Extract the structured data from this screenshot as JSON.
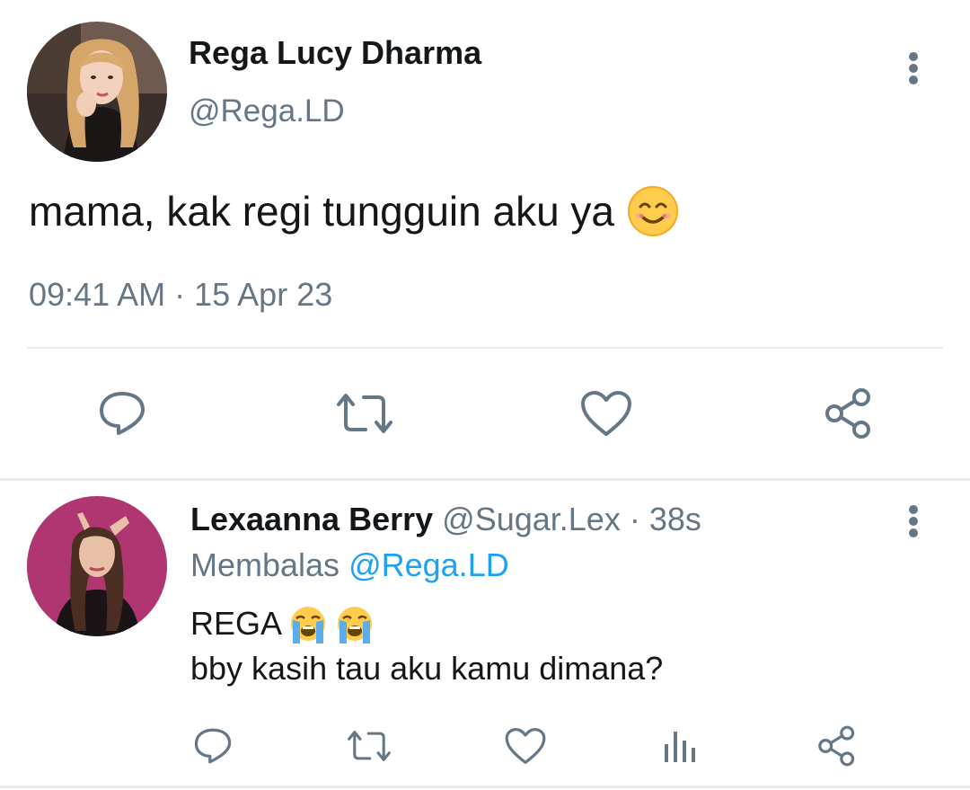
{
  "main_tweet": {
    "author_name": "Rega Lucy Dharma",
    "author_handle": "@Rega.LD",
    "text": "mama, kak regi tungguin aku ya",
    "emoji": "smiling-face-with-smiling-eyes",
    "time": "09:41 AM",
    "date": "15 Apr 23",
    "meta_separator": " · ",
    "actions": [
      "reply-icon",
      "retweet-icon",
      "like-icon",
      "share-icon"
    ]
  },
  "reply": {
    "author_name": "Lexaanna Berry",
    "author_handle": "@Sugar.Lex",
    "separator": " · ",
    "time_ago": "38s",
    "replying_label": "Membalas",
    "replying_to": "@Rega.LD",
    "text_line1": "REGA",
    "text_line1_emoji": [
      "loudly-crying-face",
      "loudly-crying-face"
    ],
    "text_line2": "bby kasih tau aku kamu dimana?",
    "actions": [
      "reply-icon",
      "retweet-icon",
      "like-icon",
      "analytics-icon",
      "share-icon"
    ]
  },
  "colors": {
    "text_primary": "#14171a",
    "text_secondary": "#657786",
    "mention": "#1da1f2",
    "divider": "#e6ecf0"
  }
}
